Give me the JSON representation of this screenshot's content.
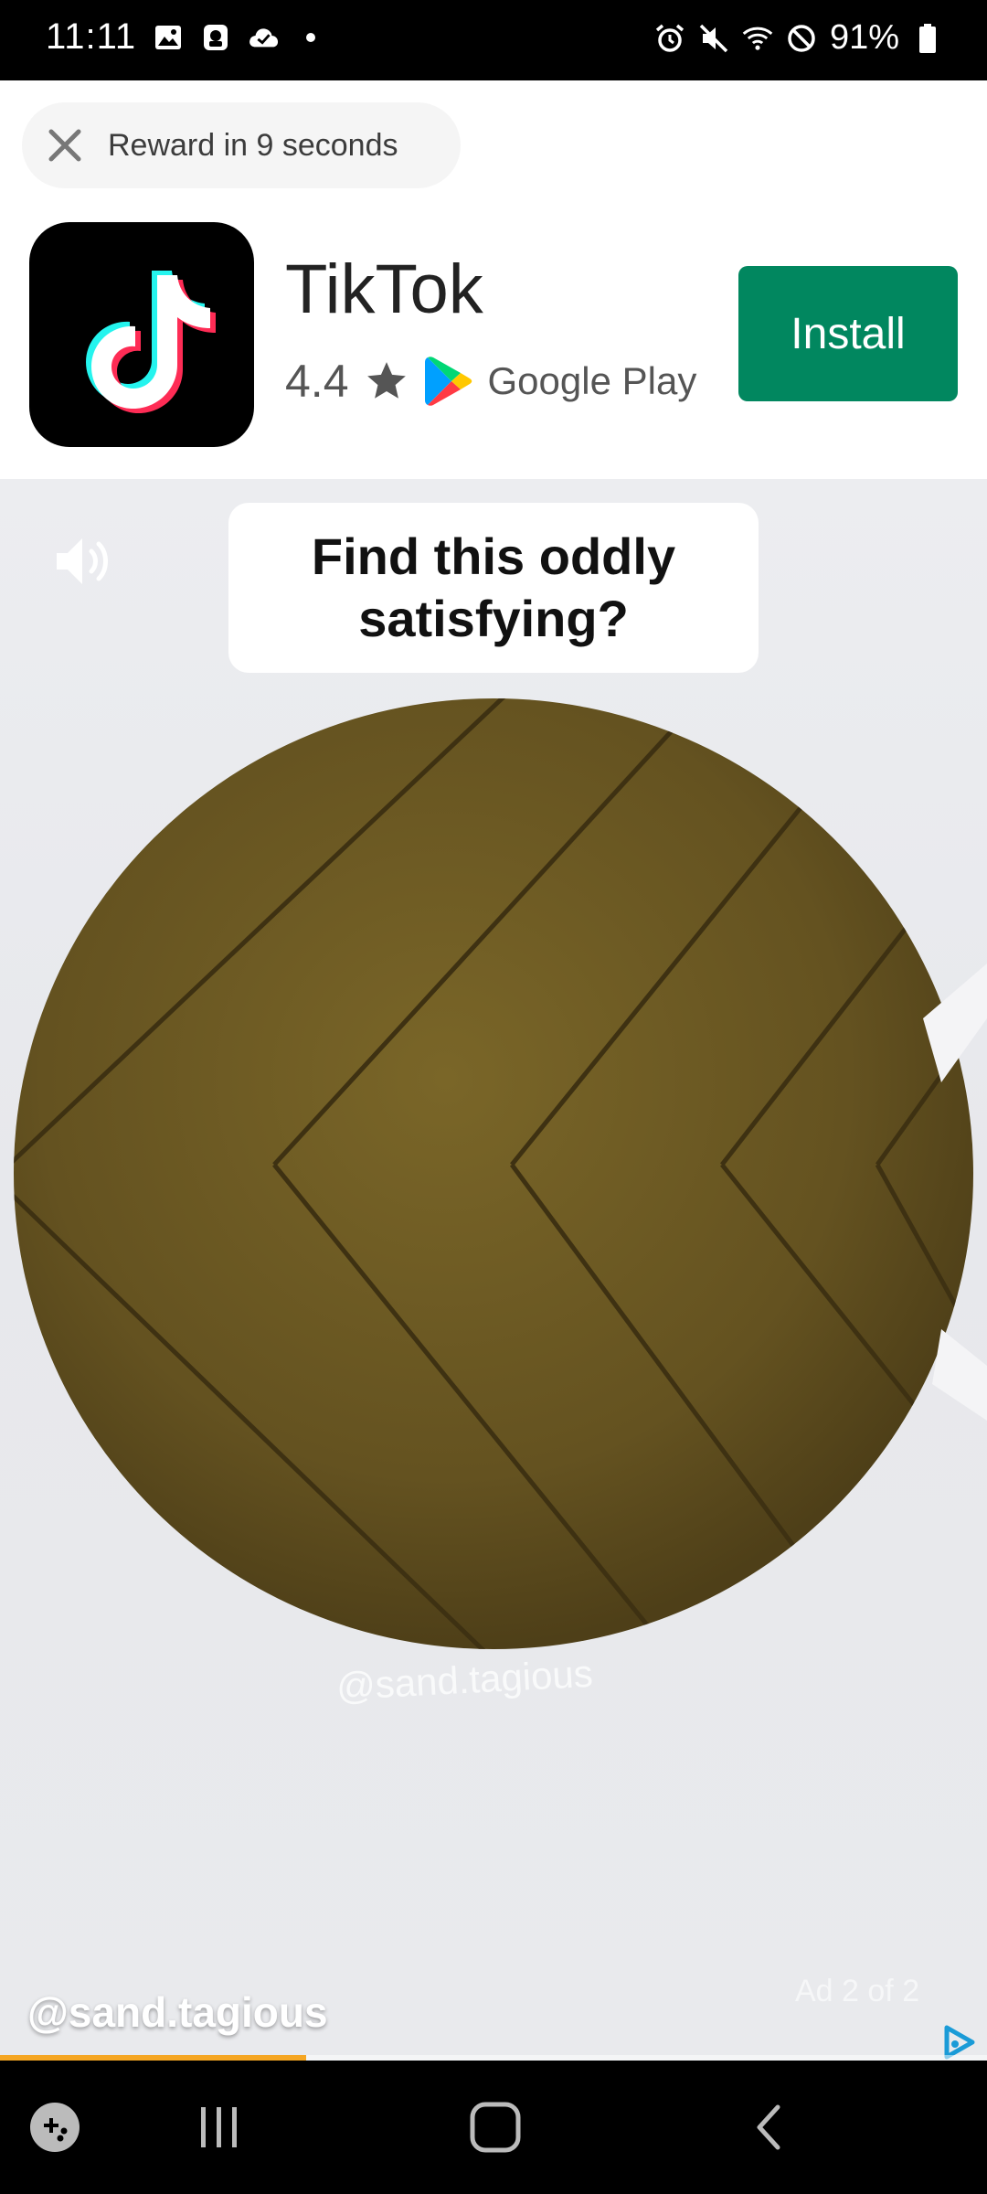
{
  "status_bar": {
    "time": "11:11",
    "battery": "91%",
    "left_icons": [
      "image-icon",
      "sim-icon",
      "cloud-check-icon",
      "dot-icon"
    ],
    "right_icons": [
      "alarm-icon",
      "mute-icon",
      "wifi-icon",
      "do-not-disturb-icon",
      "battery-icon"
    ]
  },
  "ad": {
    "reward_text": "Reward in 9 seconds",
    "app_name": "TikTok",
    "rating": "4.4",
    "store": "Google Play",
    "install_label": "Install",
    "install_color": "#01875f"
  },
  "video": {
    "caption": "Find this oddly satisfying?",
    "watermark": "@sand.tagious",
    "handle": "@sand.tagious",
    "ad_counter": "Ad 2 of 2",
    "progress_fraction": 0.31,
    "progress_color": "#f5a623"
  },
  "nav_bar": {
    "items": [
      "game-launcher-icon",
      "recent-apps-icon",
      "home-icon",
      "back-icon"
    ]
  }
}
